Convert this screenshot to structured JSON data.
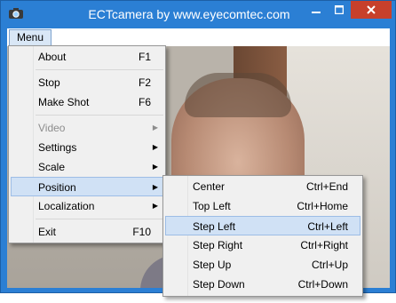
{
  "window": {
    "title": "ECTcamera by www.eyecomtec.com",
    "icon": "camera-icon",
    "controls": {
      "minimize": "minimize-icon",
      "maximize": "maximize-icon",
      "close": "close-icon"
    }
  },
  "menubar": {
    "menu_label": "Menu"
  },
  "main_menu": {
    "items": [
      {
        "label": "About",
        "shortcut": "F1"
      },
      {
        "label": "Stop",
        "shortcut": "F2"
      },
      {
        "label": "Make Shot",
        "shortcut": "F6"
      },
      {
        "label": "Video",
        "submenu": true,
        "disabled": true
      },
      {
        "label": "Settings",
        "submenu": true
      },
      {
        "label": "Scale",
        "submenu": true
      },
      {
        "label": "Position",
        "submenu": true,
        "highlighted": true
      },
      {
        "label": "Localization",
        "submenu": true
      },
      {
        "label": "Exit",
        "shortcut": "F10"
      }
    ]
  },
  "position_submenu": {
    "items": [
      {
        "label": "Center",
        "shortcut": "Ctrl+End"
      },
      {
        "label": "Top Left",
        "shortcut": "Ctrl+Home"
      },
      {
        "label": "Step Left",
        "shortcut": "Ctrl+Left",
        "highlighted": true
      },
      {
        "label": "Step Right",
        "shortcut": "Ctrl+Right"
      },
      {
        "label": "Step Up",
        "shortcut": "Ctrl+Up"
      },
      {
        "label": "Step Down",
        "shortcut": "Ctrl+Down"
      }
    ]
  },
  "colors": {
    "title_bar": "#2b7fd4",
    "close_button": "#c7402b",
    "menu_highlight": "#d0e1f5"
  }
}
